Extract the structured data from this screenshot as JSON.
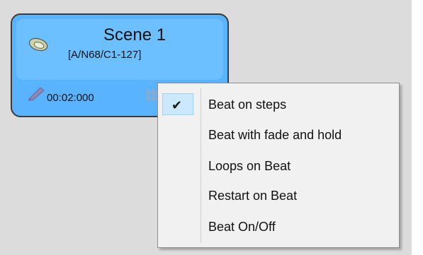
{
  "scene": {
    "title": "Scene 1",
    "subtitle": "[A/N68/C1-127]",
    "time": "00:02:000",
    "colors": {
      "card": "#5ab3ff",
      "header": "#6cc0ff",
      "border": "#3c3c3c"
    },
    "icons": {
      "scene": "speaker-cone-icon",
      "edit": "pencil-icon",
      "beat": "beat-icon"
    }
  },
  "context_menu": {
    "items": [
      {
        "label": "Beat on steps",
        "checked": true
      },
      {
        "label": "Beat with fade and hold",
        "checked": false
      },
      {
        "label": "Loops on Beat",
        "checked": false
      },
      {
        "label": "Restart on Beat",
        "checked": false
      },
      {
        "label": "Beat On/Off",
        "checked": false
      }
    ],
    "check_glyph": "✔",
    "colors": {
      "background": "#f1f1f1",
      "highlight": "#cce8ff"
    }
  }
}
